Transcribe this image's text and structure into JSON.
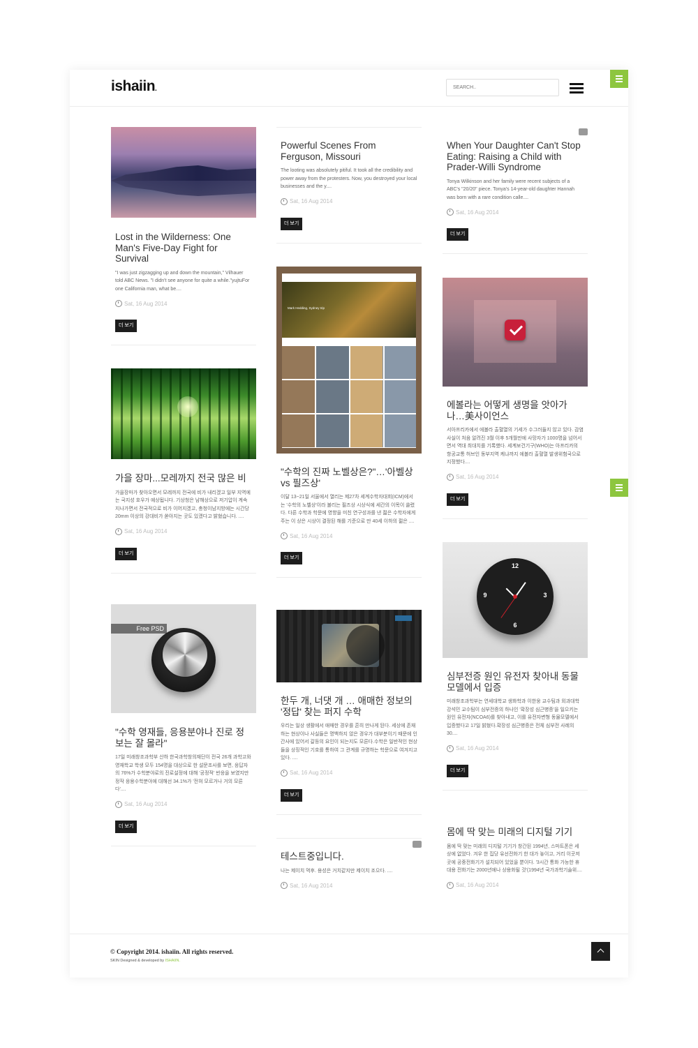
{
  "header": {
    "logo": "ishaiin",
    "logo_mark": ".",
    "search_placeholder": "SEARCH.."
  },
  "accent_color": "#8dc63f",
  "cards": [
    {
      "title": "Lost in the Wilderness: One Man's Five-Day Fight for Survival",
      "excerpt": "\"I was just zigzagging up and down the mountain,\" Vilhauer told ABC News. \"I didn't see anyone for quite a while.\"yujtuFor one California man, what be....",
      "date": "Sat, 16 Aug 2014",
      "more": "더 보기",
      "image": "lake-mountain-dusk"
    },
    {
      "title": "가을 장마...모레까지 전국 많은 비",
      "excerpt": "가을장마가 찾아오면서 모레까지 전국에 비가 내리겠고 일부 지역에는 국지성 호우가 예상됩니다. 기상청은 남해상으로 저기압이 계속 지나가면서 전국적으로 비가 이어지겠고, 충청이남지방에는 시간당 20mm 이상의 강대비가 쏟아지는 곳도 있겠다고 밝혔습니다. ....",
      "date": "Sat, 16 Aug 2014",
      "more": "더 보기",
      "image": "bamboo-forest"
    },
    {
      "title": "\"수학 영재들, 응용분야나 진로 정보는 잘 몰라\"",
      "excerpt": "17일 미래창조과학부 산하 한국과학창의재단이 전국 26개 과학고와 영재학교 학생 모두 154명을 대상으로 한 설문조사를 보면, 응답자의 76%가 수학분야로의 진로설정에 대해 '공정적' 반응을 보였지만 정작 응용수학분야에 대해선 34.1%가 '전혀 모르거나 거의 모른다'....",
      "date": "Sat, 16 Aug 2014",
      "more": "더 보기",
      "image": "knob-psd",
      "image_label": "Free PSD"
    },
    {
      "title": "Powerful Scenes From Ferguson, Missouri",
      "excerpt": "The looting was absolutely pitiful. It took all the credibility and power away from the protesters. Now, you destroyed your local businesses and the y....",
      "date": "Sat, 16 Aug 2014",
      "more": "더 보기"
    },
    {
      "title": "\"수학의 진짜 노벨상은?\"…'아벨상 vs 필즈상'",
      "excerpt": "이달 13~21일 서울에서 열리는 제27차 세계수학자대회(ICM)에서는 '수학의 노벨상'이라 불리는 필즈상 시상식에 세간의 이목이 쏠렸다. 다른 수학과 학문에 영향을 미친 연구성과를 낸 젊은 수학자에게 주는 이 상은 시상이 결정된 해를 기준으로 만 40세 이하의 젊은 ....",
      "date": "Sat, 16 Aug 2014",
      "more": "더 보기",
      "image": "photo-app-screenshot",
      "image_caption": "Mark Hedding, Sydney trip"
    },
    {
      "title": "한두 개, 너댓 개 … 애매한 정보의 '정답' 찾는 퍼지 수학",
      "excerpt": "우리는 일상 생활에서 애매한 경우를 흔히 만나게 된다. 세상에 존재하는 현상이나 사실들은 명백하지 않은 경우가 대부분이기 때문에 인간사에 있어서 갈등의 요인이 되는지도 모른다.수학은 일반적인 현상들을 상징적인 기호를 통하여 그 관계를 규명하는 학문으로 여겨지고 있다. ....",
      "date": "Sat, 16 Aug 2014",
      "more": "더 보기",
      "image": "dark-wood-ui"
    },
    {
      "title": "테스트중입니다.",
      "excerpt": "나는 제이치 먹후. 용성은 거치같지만 제이치 조으다. ....",
      "date": "Sat, 16 Aug 2014",
      "more": ""
    },
    {
      "title": "When Your Daughter Can't Stop Eating: Raising a Child with Prader-Willi Syndrome",
      "excerpt": "Tonya Wilkinson and her family were recent subjects of a ABC's \"20/20\" piece. Tonya's 14-year-old daughter Hannah was born with a rare condition calle....",
      "date": "Sat, 16 Aug 2014",
      "more": "더 보기"
    },
    {
      "title": "에볼라는 어떻게 생명을 앗아가나…美사이언스",
      "excerpt": "서아프리카에서 에볼라 출혈열의 기세가 수그러들지 않고 있다. 감염 사실이 처음 알려진 3월 이후 5개월만에 사망자가 1000명을 넘어서면서 역대 최대치를 기록했다. 세계보건기구(WHO)는 아프리카의 항공교통 허브인 동부지역 케냐까지 에볼라 출혈열 발생위험국으로 지정했다....",
      "date": "Sat, 16 Aug 2014",
      "more": "더 보기",
      "image": "check-app-icon"
    },
    {
      "title": "심부전증 원인 유전자 찾아내 동물모델에서 입증",
      "excerpt": "미래창조과학부는 연세대학교 생화학과 이한웅 교수팀과 외과대학 강석민 교수팀이 심부전증의 하나인 '확장성 심근병증'을 일으키는 원인 유전자(NCOA6)를 찾아내고, 이를 유전자변형 동물모델에서 입증했다고 17일 밝혔다.확장성 심근병증은 전체 심부전 사례의 30....",
      "date": "Sat, 16 Aug 2014",
      "more": "더 보기",
      "image": "clock-icon",
      "clock": [
        "12",
        "3",
        "6",
        "9"
      ]
    },
    {
      "title": "몸에 딱 맞는 미래의 디지털 기기",
      "excerpt": "몸에 딱 맞는 미래의 디지털 기기가 창간된 1994년, 스마트폰은 세상에 없었다. 겨우 한 집당 유선전화기 한 대가 놓이고, 거리 이곳저곳에 공중전화기가 설치되어 있었을 뿐이다. '3시간 통화 가능한 휴대용 전화기는 2000년에나 상용화될 것'(1994년 국가과학기술위....",
      "date": "Sat, 16 Aug 2014",
      "more": ""
    }
  ],
  "footer": {
    "copyright": "© Copyright 2014. ishaiin. All rights reserved.",
    "skin_prefix": "SKIN Designed & developed by ",
    "skin_brand": "ISHAIIN."
  }
}
